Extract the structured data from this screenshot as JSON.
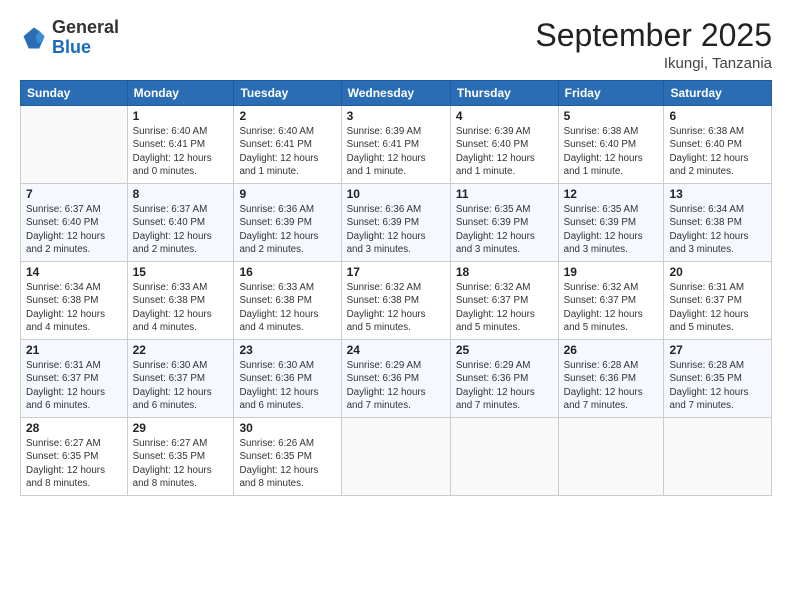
{
  "logo": {
    "general": "General",
    "blue": "Blue"
  },
  "header": {
    "month": "September 2025",
    "location": "Ikungi, Tanzania"
  },
  "days_of_week": [
    "Sunday",
    "Monday",
    "Tuesday",
    "Wednesday",
    "Thursday",
    "Friday",
    "Saturday"
  ],
  "weeks": [
    [
      {
        "day": "",
        "info": ""
      },
      {
        "day": "1",
        "info": "Sunrise: 6:40 AM\nSunset: 6:41 PM\nDaylight: 12 hours\nand 0 minutes."
      },
      {
        "day": "2",
        "info": "Sunrise: 6:40 AM\nSunset: 6:41 PM\nDaylight: 12 hours\nand 1 minute."
      },
      {
        "day": "3",
        "info": "Sunrise: 6:39 AM\nSunset: 6:41 PM\nDaylight: 12 hours\nand 1 minute."
      },
      {
        "day": "4",
        "info": "Sunrise: 6:39 AM\nSunset: 6:40 PM\nDaylight: 12 hours\nand 1 minute."
      },
      {
        "day": "5",
        "info": "Sunrise: 6:38 AM\nSunset: 6:40 PM\nDaylight: 12 hours\nand 1 minute."
      },
      {
        "day": "6",
        "info": "Sunrise: 6:38 AM\nSunset: 6:40 PM\nDaylight: 12 hours\nand 2 minutes."
      }
    ],
    [
      {
        "day": "7",
        "info": "Sunrise: 6:37 AM\nSunset: 6:40 PM\nDaylight: 12 hours\nand 2 minutes."
      },
      {
        "day": "8",
        "info": "Sunrise: 6:37 AM\nSunset: 6:40 PM\nDaylight: 12 hours\nand 2 minutes."
      },
      {
        "day": "9",
        "info": "Sunrise: 6:36 AM\nSunset: 6:39 PM\nDaylight: 12 hours\nand 2 minutes."
      },
      {
        "day": "10",
        "info": "Sunrise: 6:36 AM\nSunset: 6:39 PM\nDaylight: 12 hours\nand 3 minutes."
      },
      {
        "day": "11",
        "info": "Sunrise: 6:35 AM\nSunset: 6:39 PM\nDaylight: 12 hours\nand 3 minutes."
      },
      {
        "day": "12",
        "info": "Sunrise: 6:35 AM\nSunset: 6:39 PM\nDaylight: 12 hours\nand 3 minutes."
      },
      {
        "day": "13",
        "info": "Sunrise: 6:34 AM\nSunset: 6:38 PM\nDaylight: 12 hours\nand 3 minutes."
      }
    ],
    [
      {
        "day": "14",
        "info": "Sunrise: 6:34 AM\nSunset: 6:38 PM\nDaylight: 12 hours\nand 4 minutes."
      },
      {
        "day": "15",
        "info": "Sunrise: 6:33 AM\nSunset: 6:38 PM\nDaylight: 12 hours\nand 4 minutes."
      },
      {
        "day": "16",
        "info": "Sunrise: 6:33 AM\nSunset: 6:38 PM\nDaylight: 12 hours\nand 4 minutes."
      },
      {
        "day": "17",
        "info": "Sunrise: 6:32 AM\nSunset: 6:38 PM\nDaylight: 12 hours\nand 5 minutes."
      },
      {
        "day": "18",
        "info": "Sunrise: 6:32 AM\nSunset: 6:37 PM\nDaylight: 12 hours\nand 5 minutes."
      },
      {
        "day": "19",
        "info": "Sunrise: 6:32 AM\nSunset: 6:37 PM\nDaylight: 12 hours\nand 5 minutes."
      },
      {
        "day": "20",
        "info": "Sunrise: 6:31 AM\nSunset: 6:37 PM\nDaylight: 12 hours\nand 5 minutes."
      }
    ],
    [
      {
        "day": "21",
        "info": "Sunrise: 6:31 AM\nSunset: 6:37 PM\nDaylight: 12 hours\nand 6 minutes."
      },
      {
        "day": "22",
        "info": "Sunrise: 6:30 AM\nSunset: 6:37 PM\nDaylight: 12 hours\nand 6 minutes."
      },
      {
        "day": "23",
        "info": "Sunrise: 6:30 AM\nSunset: 6:36 PM\nDaylight: 12 hours\nand 6 minutes."
      },
      {
        "day": "24",
        "info": "Sunrise: 6:29 AM\nSunset: 6:36 PM\nDaylight: 12 hours\nand 7 minutes."
      },
      {
        "day": "25",
        "info": "Sunrise: 6:29 AM\nSunset: 6:36 PM\nDaylight: 12 hours\nand 7 minutes."
      },
      {
        "day": "26",
        "info": "Sunrise: 6:28 AM\nSunset: 6:36 PM\nDaylight: 12 hours\nand 7 minutes."
      },
      {
        "day": "27",
        "info": "Sunrise: 6:28 AM\nSunset: 6:35 PM\nDaylight: 12 hours\nand 7 minutes."
      }
    ],
    [
      {
        "day": "28",
        "info": "Sunrise: 6:27 AM\nSunset: 6:35 PM\nDaylight: 12 hours\nand 8 minutes."
      },
      {
        "day": "29",
        "info": "Sunrise: 6:27 AM\nSunset: 6:35 PM\nDaylight: 12 hours\nand 8 minutes."
      },
      {
        "day": "30",
        "info": "Sunrise: 6:26 AM\nSunset: 6:35 PM\nDaylight: 12 hours\nand 8 minutes."
      },
      {
        "day": "",
        "info": ""
      },
      {
        "day": "",
        "info": ""
      },
      {
        "day": "",
        "info": ""
      },
      {
        "day": "",
        "info": ""
      }
    ]
  ]
}
